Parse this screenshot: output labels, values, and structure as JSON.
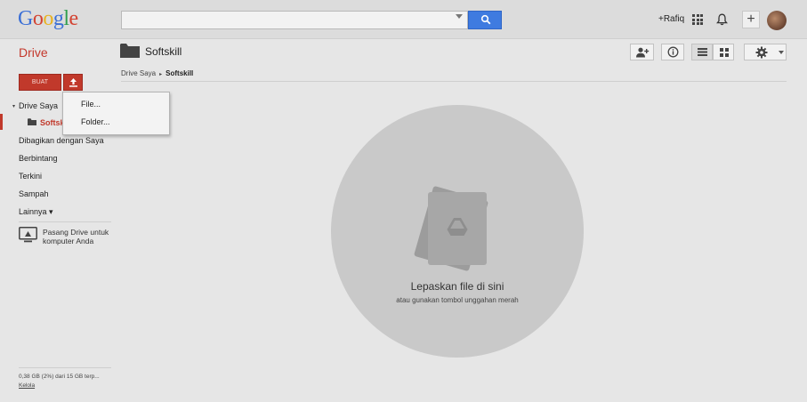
{
  "header": {
    "logo_letters": [
      {
        "ch": "G",
        "color": "#3b6fd6"
      },
      {
        "ch": "o",
        "color": "#d34332"
      },
      {
        "ch": "o",
        "color": "#e8b221"
      },
      {
        "ch": "g",
        "color": "#3b6fd6"
      },
      {
        "ch": "l",
        "color": "#2f9e4f"
      },
      {
        "ch": "e",
        "color": "#d34332"
      }
    ],
    "search_value": "",
    "user_link": "+Rafiq",
    "plus_label": "+",
    "icons": [
      "search-icon",
      "apps-icon",
      "notifications-icon",
      "avatar"
    ]
  },
  "app": {
    "title": "Drive",
    "accent": "#c1392b"
  },
  "toolbar": {
    "folder_name": "Softskill",
    "buttons": [
      "share-icon",
      "info-icon",
      "list-view-icon",
      "grid-view-icon",
      "settings-icon"
    ]
  },
  "breadcrumb": {
    "root": "Drive Saya",
    "separator": "▸",
    "current": "Softskill"
  },
  "sidebar": {
    "create_label": "BUAT",
    "tree_caret": "▾",
    "items": [
      {
        "label": "Drive Saya"
      },
      {
        "label": "Softskill"
      },
      {
        "label": "Dibagikan dengan Saya"
      },
      {
        "label": "Berbintang"
      },
      {
        "label": "Terkini"
      },
      {
        "label": "Sampah"
      },
      {
        "label": "Lainnya ▾"
      }
    ],
    "install_text": "Pasang Drive untuk komputer Anda",
    "storage_text": "0,38 GB (2%) dari 15 GB terp...",
    "manage_link": "Kelola"
  },
  "upload_menu": {
    "items": [
      {
        "label": "File..."
      },
      {
        "label": "Folder..."
      }
    ]
  },
  "dropzone": {
    "title": "Lepaskan file di sini",
    "subtitle": "atau gunakan tombol unggahan merah"
  }
}
